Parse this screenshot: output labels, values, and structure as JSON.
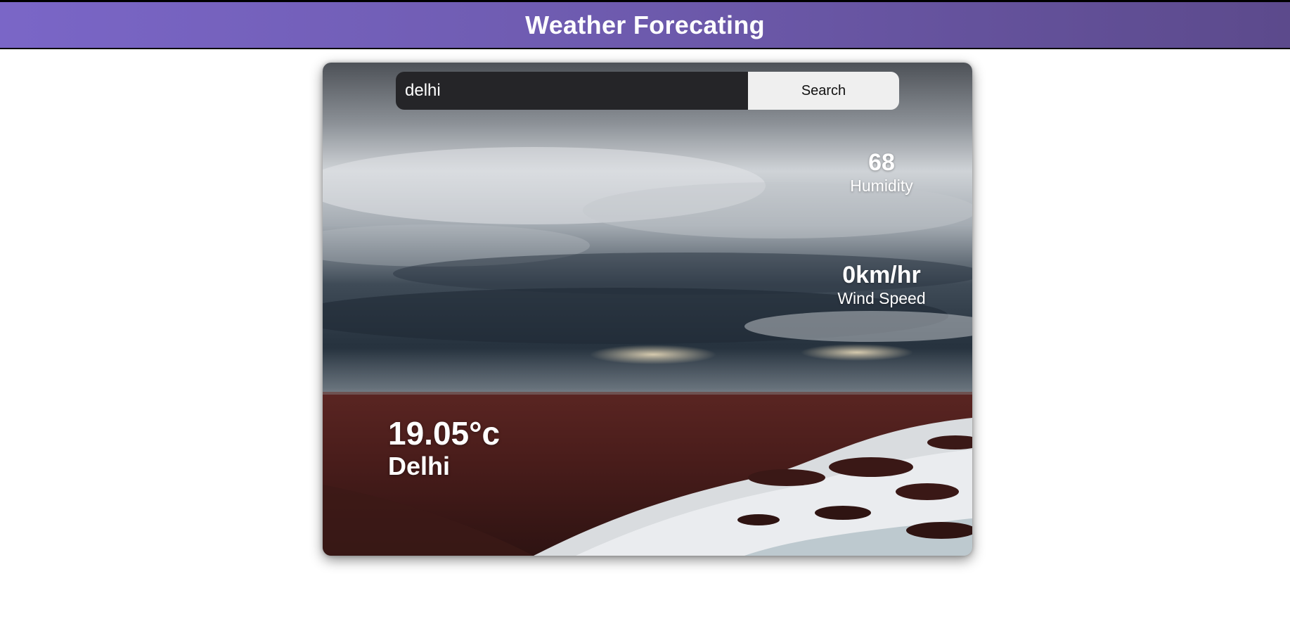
{
  "header": {
    "title": "Weather Forecating"
  },
  "search": {
    "value": "delhi",
    "button_label": "Search"
  },
  "humidity": {
    "value": "68",
    "label": "Humidity"
  },
  "wind": {
    "value": "0km/hr",
    "label": "Wind Speed"
  },
  "current": {
    "temperature": "19.05°c",
    "city": "Delhi"
  },
  "colors": {
    "header_gradient_start": "#7a66c7",
    "header_gradient_end": "#5c4a8c",
    "search_input_bg": "#252528",
    "search_button_bg": "#efefef"
  }
}
